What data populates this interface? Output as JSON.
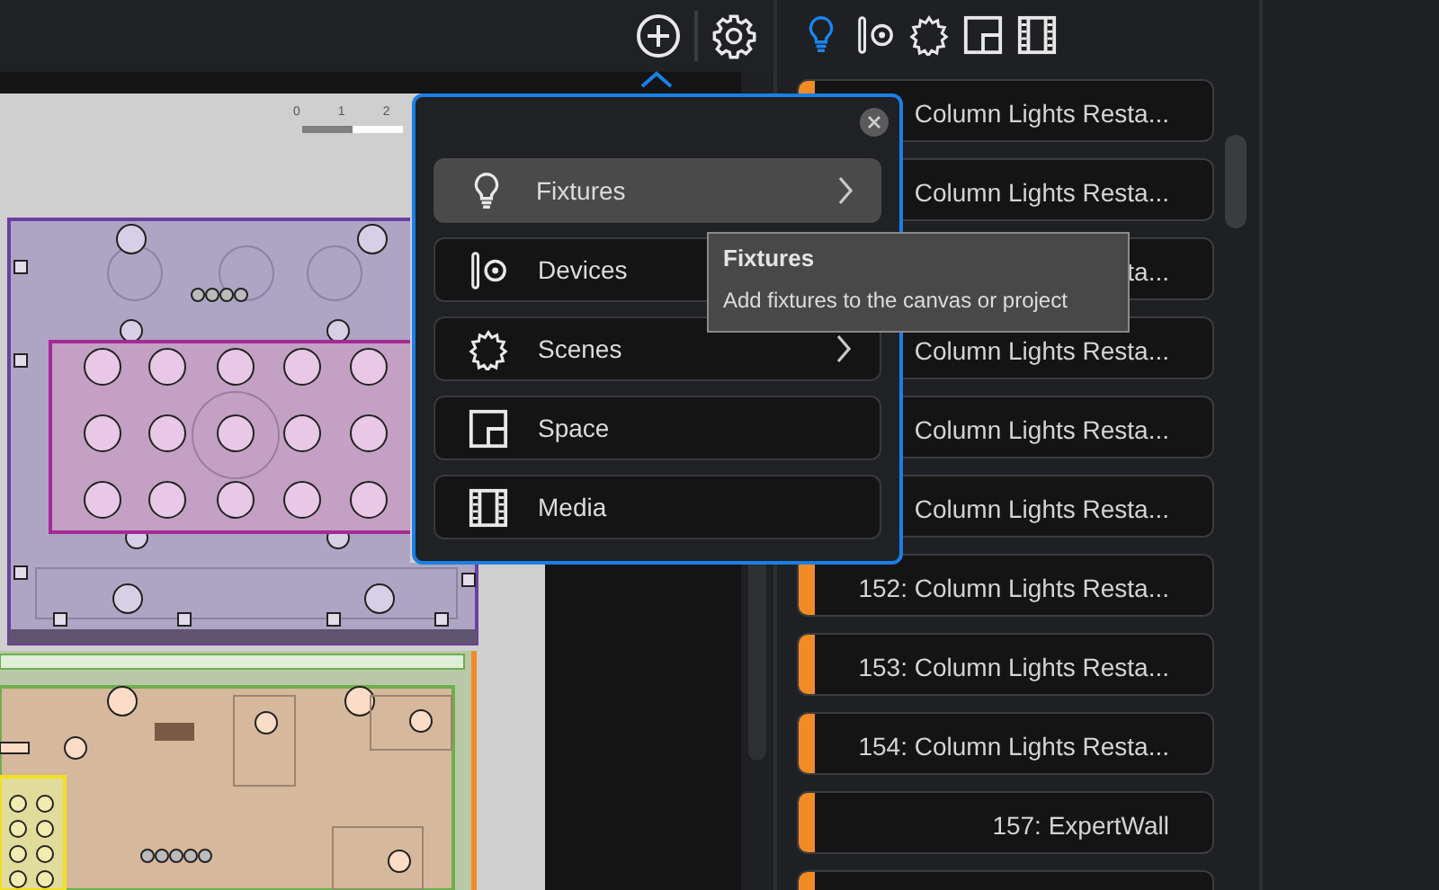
{
  "toolbar": {
    "add_selected": true
  },
  "canvas": {
    "scale_bar": [
      "0",
      "1",
      "2"
    ]
  },
  "add_menu": {
    "items": [
      {
        "label": "Fixtures",
        "kind": "bulb",
        "selected": true,
        "has_submenu": true
      },
      {
        "label": "Devices",
        "kind": "device",
        "selected": false,
        "has_submenu": false
      },
      {
        "label": "Scenes",
        "kind": "scene",
        "selected": false,
        "has_submenu": true
      },
      {
        "label": "Space",
        "kind": "space",
        "selected": false,
        "has_submenu": false
      },
      {
        "label": "Media",
        "kind": "media",
        "selected": false,
        "has_submenu": false
      }
    ],
    "tooltip": {
      "title": "Fixtures",
      "description": "Add fixtures to the canvas or project"
    }
  },
  "library": {
    "tabs": [
      {
        "kind": "bulb",
        "selected": true
      },
      {
        "kind": "device",
        "selected": false
      },
      {
        "kind": "scene",
        "selected": false
      },
      {
        "kind": "space",
        "selected": false
      },
      {
        "kind": "media",
        "selected": false
      }
    ],
    "items": [
      {
        "text": "Column Lights Resta...",
        "color": "#f28a25"
      },
      {
        "text": "Column Lights Resta..."
      },
      {
        "text": "ta..."
      },
      {
        "text": "Column Lights Resta..."
      },
      {
        "text": "Column Lights Resta..."
      },
      {
        "text": "Column Lights Resta..."
      },
      {
        "text": "152: Column Lights Resta...",
        "color": "#f28a25"
      },
      {
        "text": "153: Column Lights Resta...",
        "color": "#f28a25"
      },
      {
        "text": "154: Column Lights Resta...",
        "color": "#f28a25"
      },
      {
        "text": "157: ExpertWall",
        "color": "#f28a25"
      },
      {
        "color": "#f28a25"
      }
    ]
  }
}
